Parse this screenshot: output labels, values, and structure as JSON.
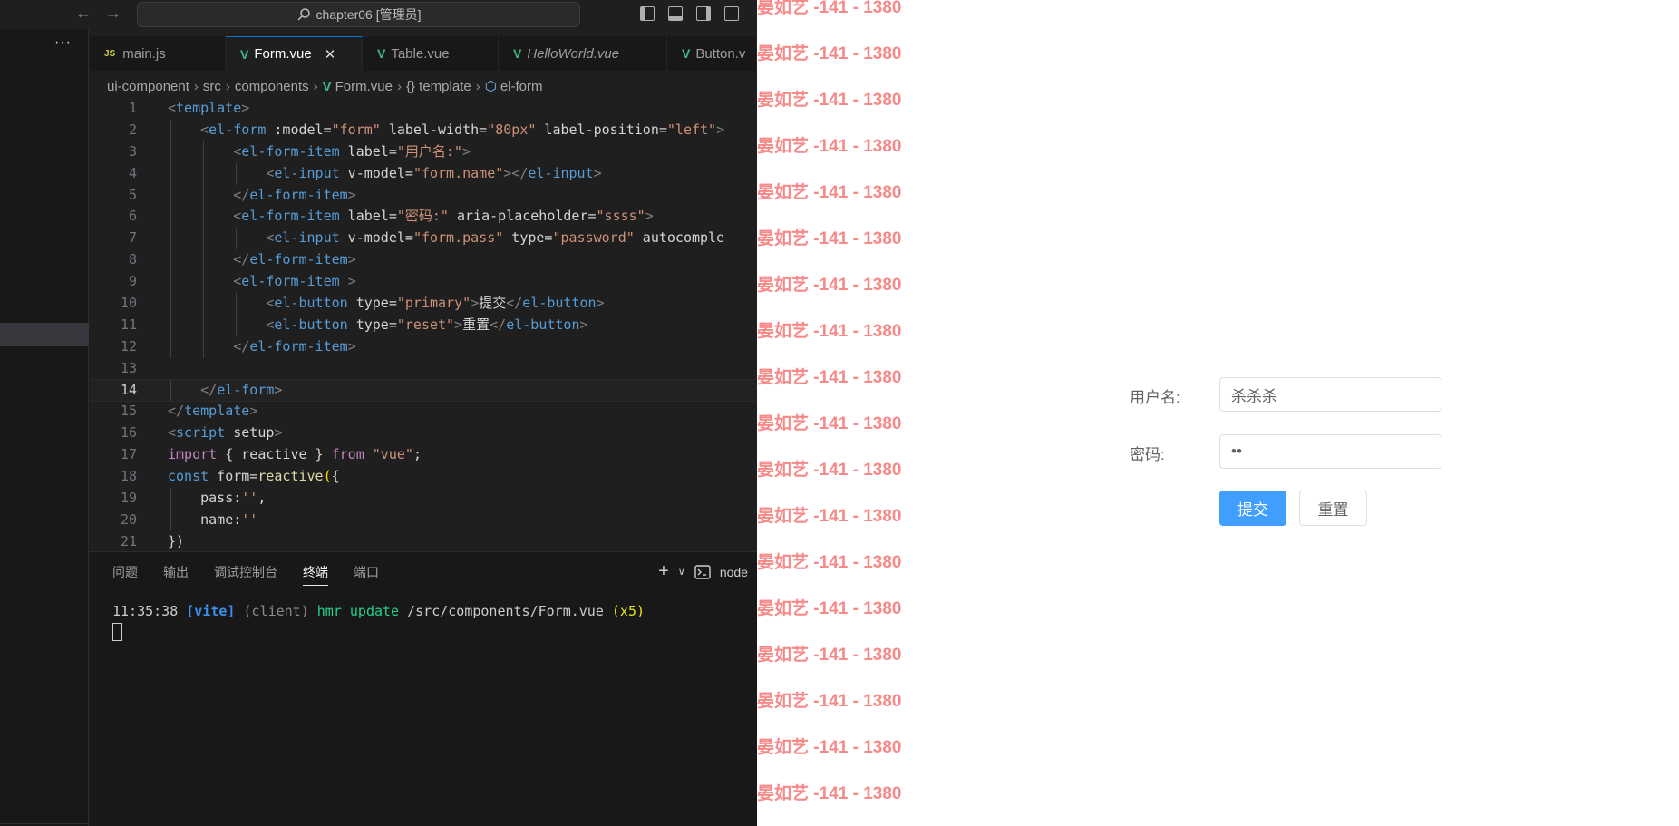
{
  "titlebar": {
    "search_text": "chapter06 [管理员]"
  },
  "tabs": [
    {
      "label": "main.js",
      "icon": "js-icon",
      "active": false
    },
    {
      "label": "Form.vue",
      "icon": "vue-icon",
      "active": true
    },
    {
      "label": "Table.vue",
      "icon": "vue-icon",
      "active": false
    },
    {
      "label": "HelloWorld.vue",
      "icon": "vue-icon",
      "active": false
    },
    {
      "label": "Button.v",
      "icon": "vue-icon",
      "active": false
    }
  ],
  "breadcrumb": {
    "parts": [
      "ui-component",
      "src",
      "components",
      "Form.vue",
      "{} template",
      "el-form"
    ]
  },
  "code": {
    "current_line": 14,
    "lines": [
      {
        "n": "1",
        "text": "<template>"
      },
      {
        "n": "2",
        "text": "    <el-form :model=\"form\" label-width=\"80px\" label-position=\"left\">"
      },
      {
        "n": "3",
        "text": "        <el-form-item label=\"用户名:\">"
      },
      {
        "n": "4",
        "text": "            <el-input v-model=\"form.name\"></el-input>"
      },
      {
        "n": "5",
        "text": "        </el-form-item>"
      },
      {
        "n": "6",
        "text": "        <el-form-item label=\"密码:\" aria-placeholder=\"ssss\">"
      },
      {
        "n": "7",
        "text": "            <el-input v-model=\"form.pass\" type=\"password\" autocomple"
      },
      {
        "n": "8",
        "text": "        </el-form-item>"
      },
      {
        "n": "9",
        "text": "        <el-form-item >"
      },
      {
        "n": "10",
        "text": "            <el-button type=\"primary\">提交</el-button>"
      },
      {
        "n": "11",
        "text": "            <el-button type=\"reset\">重置</el-button>"
      },
      {
        "n": "12",
        "text": "        </el-form-item>"
      },
      {
        "n": "13",
        "text": ""
      },
      {
        "n": "14",
        "text": "    </el-form>"
      },
      {
        "n": "15",
        "text": "</template>"
      },
      {
        "n": "16",
        "text": "<script setup>"
      },
      {
        "n": "17",
        "text": "import { reactive } from \"vue\";"
      },
      {
        "n": "18",
        "text": "const form=reactive({"
      },
      {
        "n": "19",
        "text": "    pass:'',"
      },
      {
        "n": "20",
        "text": "    name:''"
      },
      {
        "n": "21",
        "text": "})"
      }
    ]
  },
  "panel": {
    "tabs": [
      "问题",
      "输出",
      "调试控制台",
      "终端",
      "端口"
    ],
    "active_tab": "终端",
    "terminal_label": "node",
    "terminal": {
      "time": "11:35:38",
      "tag": "[vite]",
      "client": "(client)",
      "msg": "hmr update",
      "path": "/src/components/Form.vue",
      "count": "(x5)"
    }
  },
  "browser": {
    "watermark": "晏如艺 -141 - 1380",
    "form": {
      "username_label": "用户名:",
      "username_value": "杀杀杀",
      "password_label": "密码:",
      "password_value": "••",
      "submit_label": "提交",
      "reset_label": "重置"
    }
  },
  "colors": {
    "editor_bg": "#1f1f1f",
    "watermark": "#f78989",
    "primary_button": "#409eff"
  }
}
